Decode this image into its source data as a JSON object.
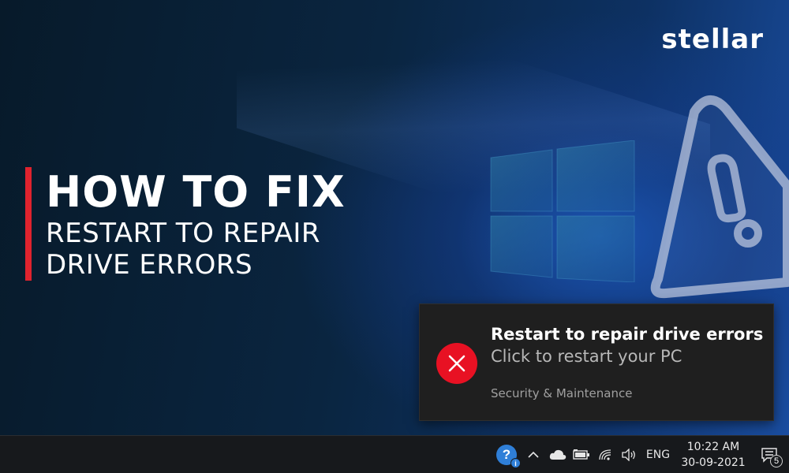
{
  "brand": {
    "logo_text": "stellar"
  },
  "headline": {
    "main": "HOW TO FIX",
    "sub_line1": "RESTART TO REPAIR",
    "sub_line2": "DRIVE ERRORS"
  },
  "toast": {
    "title": "Restart to repair drive errors",
    "body": "Click to restart your PC",
    "source": "Security & Maintenance",
    "icon": "error-circle-icon",
    "icon_color": "#e81123"
  },
  "taskbar": {
    "tray_icons": [
      "help-icon",
      "chevron-up-icon",
      "cloud-icon",
      "battery-icon",
      "wifi-icon",
      "volume-icon"
    ],
    "language": "ENG",
    "time": "10:22 AM",
    "date": "30-09-2021",
    "notification_count": "5"
  },
  "colors": {
    "accent_red": "#e0232e",
    "taskbar_bg": "#17191c",
    "toast_bg": "#1f1f1f"
  }
}
